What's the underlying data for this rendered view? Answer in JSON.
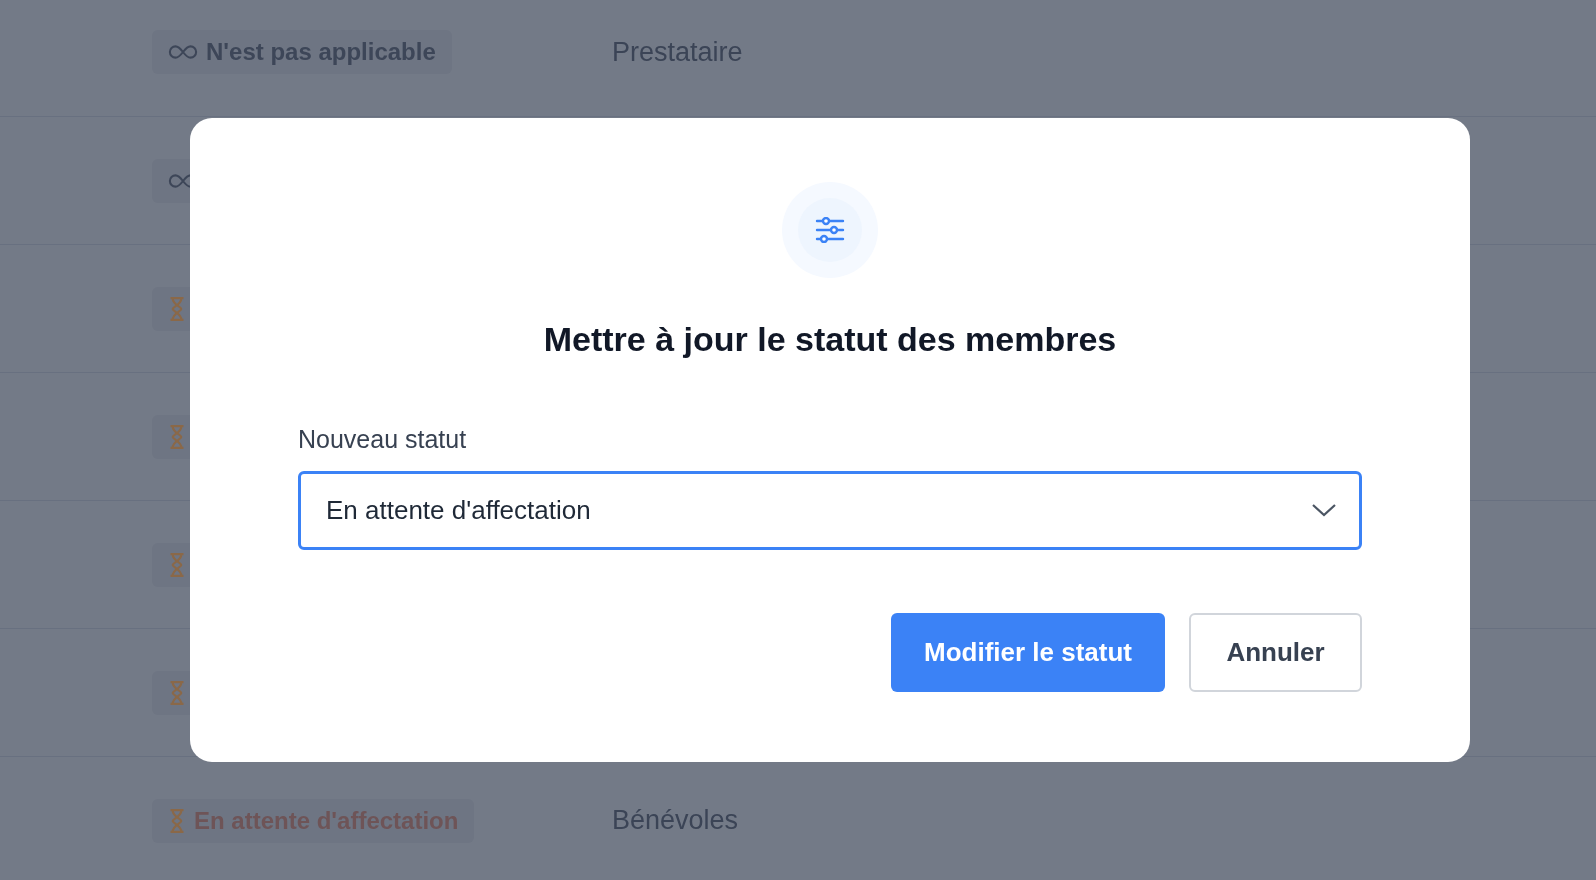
{
  "rows": [
    {
      "status": {
        "kind": "not_applicable",
        "label": "N'est pas applicable"
      },
      "type": "Prestataire"
    },
    {
      "status": {
        "kind": "not_applicable"
      }
    },
    {
      "status": {
        "kind": "pending"
      }
    },
    {
      "status": {
        "kind": "pending"
      }
    },
    {
      "status": {
        "kind": "pending"
      }
    },
    {
      "status": {
        "kind": "pending"
      }
    },
    {
      "status": {
        "kind": "pending",
        "label": "En attente d'affectation"
      },
      "type": "Bénévoles"
    }
  ],
  "dialog": {
    "title": "Mettre à jour le statut des membres",
    "field_label": "Nouveau statut",
    "select": {
      "value": "En attente d'affectation"
    },
    "buttons": [
      {
        "kind": "primary",
        "label": "Modifier le statut"
      },
      {
        "kind": "secondary",
        "label": "Annuler"
      }
    ]
  }
}
